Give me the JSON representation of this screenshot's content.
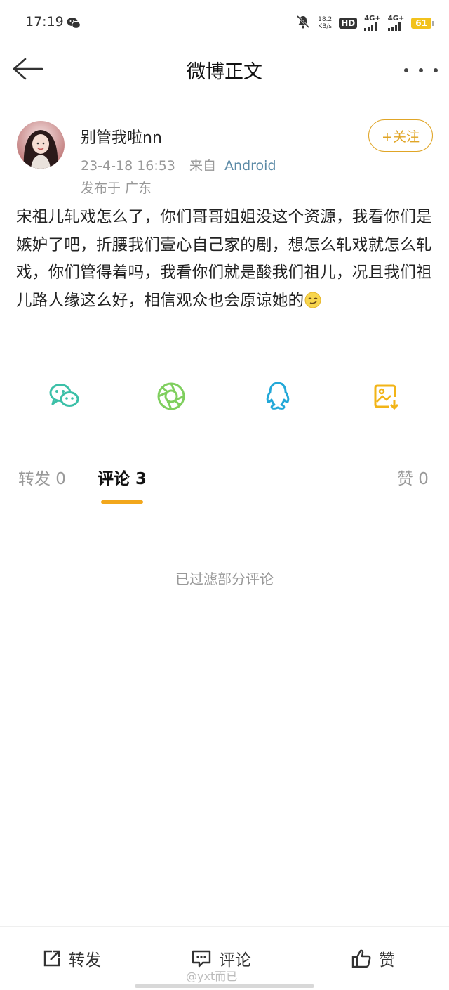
{
  "status_bar": {
    "time": "17:19",
    "net_speed_value": "18.2",
    "net_speed_unit": "KB/s",
    "hd_label": "HD",
    "signal_1": "4G+",
    "signal_2": "4G+",
    "battery": "61"
  },
  "header": {
    "title": "微博正文"
  },
  "post": {
    "author_name": "别管我啦nn",
    "date": "23-4-18 16:53",
    "source_prefix": "来自",
    "source": "Android",
    "location": "发布于 广东",
    "follow_label": "+关注",
    "text": "宋祖儿轧戏怎么了，你们哥哥姐姐没这个资源，我看你们是嫉妒了吧，折腰我们壹心自己家的剧，想怎么轧戏就怎么轧戏，你们管得着吗，我看你们就是酸我们祖儿，况且我们祖儿路人缘这么好，相信观众也会原谅她的"
  },
  "share": {
    "icons": [
      "wechat-icon",
      "moments-icon",
      "qq-icon",
      "save-image-icon"
    ],
    "colors": {
      "wechat": "#3cc0a8",
      "moments": "#7fcf5e",
      "qq": "#22a8d8",
      "save": "#f2b417"
    }
  },
  "tabs": {
    "repost": "转发 0",
    "comment": "评论 3",
    "like": "赞 0"
  },
  "filter_note": "已过滤部分评论",
  "bottom_bar": {
    "repost": "转发",
    "comment": "评论",
    "like": "赞"
  },
  "watermark": "@yxt而已",
  "accent_color": "#f2a71c"
}
